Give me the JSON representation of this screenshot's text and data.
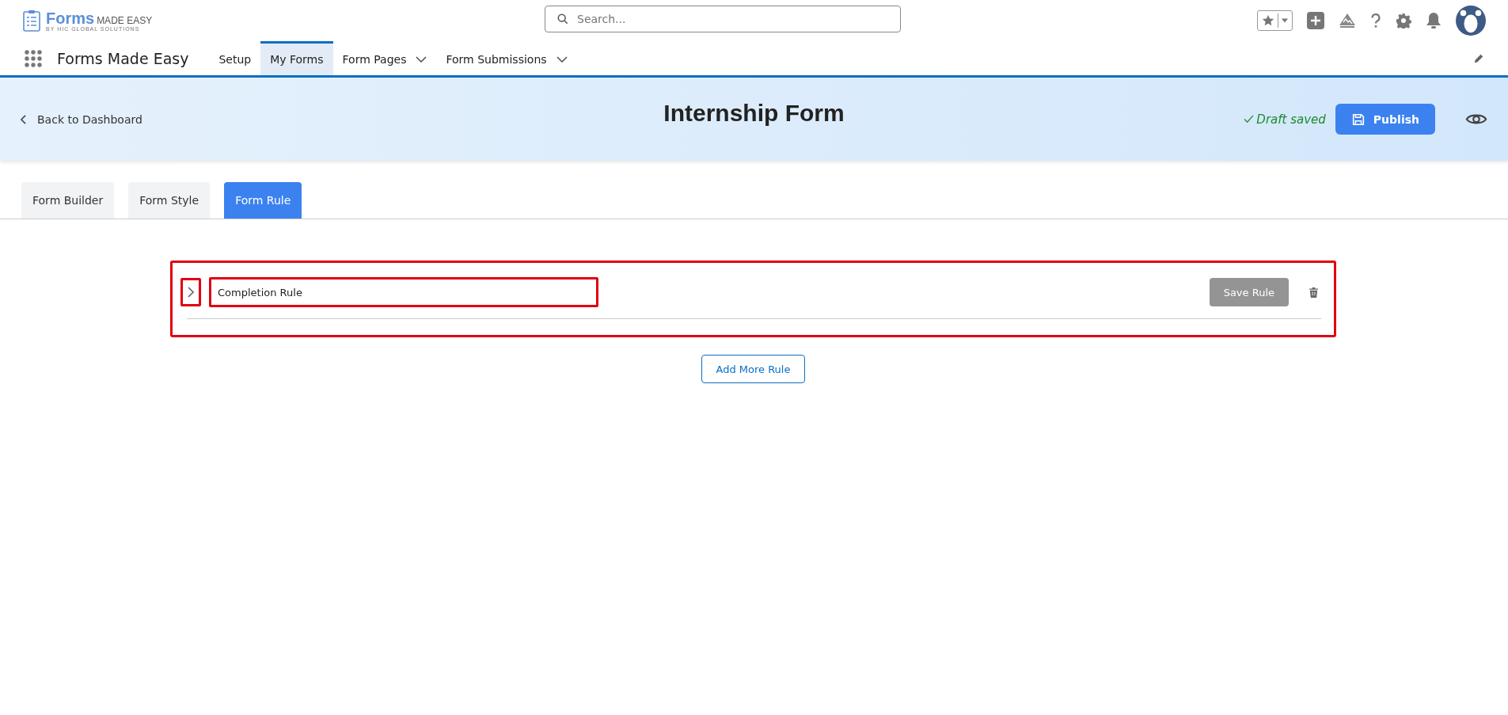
{
  "logo": {
    "word": "Forms",
    "suffix": "MADE EASY",
    "tagline": "BY HIC GLOBAL SOLUTIONS"
  },
  "search": {
    "placeholder": "Search..."
  },
  "app_name": "Forms Made Easy",
  "nav_tabs": [
    {
      "label": "Setup",
      "selected": false,
      "dropdown": false
    },
    {
      "label": "My Forms",
      "selected": true,
      "dropdown": false
    },
    {
      "label": "Form Pages",
      "selected": false,
      "dropdown": true
    },
    {
      "label": "Form Submissions",
      "selected": false,
      "dropdown": true
    }
  ],
  "banner": {
    "back_link": "Back to Dashboard",
    "title": "Internship Form",
    "status": "Draft saved",
    "publish_button": "Publish"
  },
  "builder_tabs": [
    {
      "label": "Form Builder",
      "selected": false
    },
    {
      "label": "Form Style",
      "selected": false
    },
    {
      "label": "Form Rule",
      "selected": true
    }
  ],
  "rules": [
    {
      "name": "Completion Rule",
      "expanded": false,
      "save_button": "Save Rule",
      "save_disabled": true
    }
  ],
  "add_button": "Add More Rule"
}
